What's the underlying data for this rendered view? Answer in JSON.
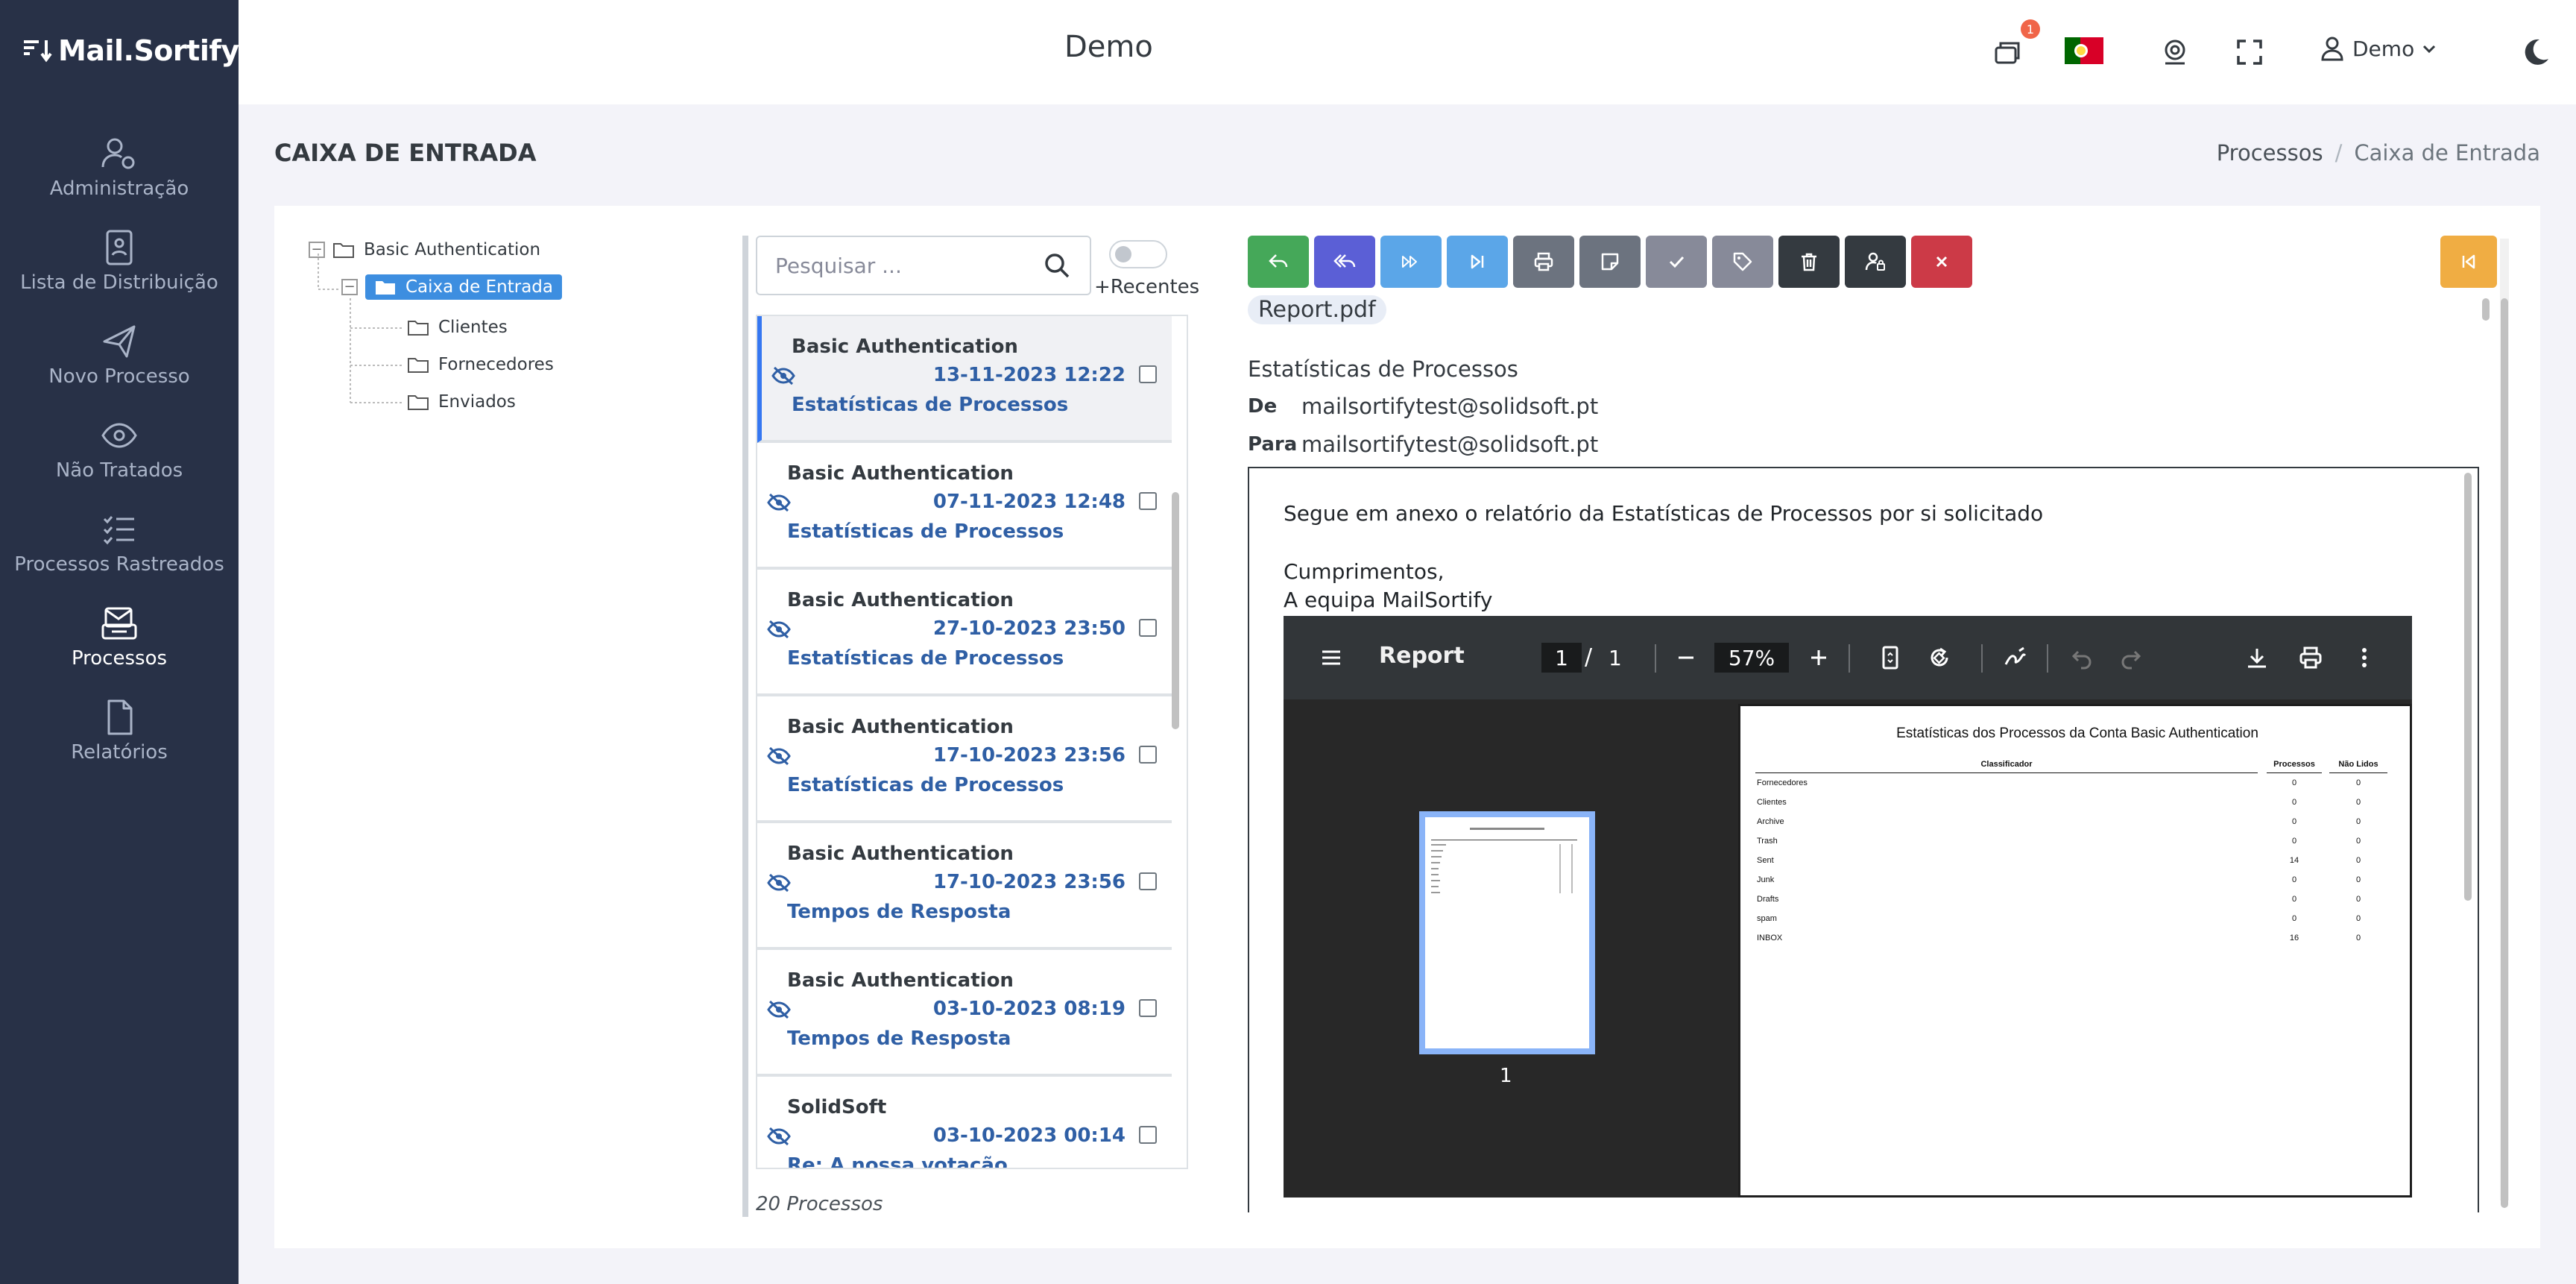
{
  "app": {
    "logo": "Mail.Sortify",
    "header_title": "Demo",
    "notification_count": "1",
    "user_name": "Demo"
  },
  "sidebar": {
    "items": [
      {
        "label": "Administração",
        "icon": "users-gear-icon"
      },
      {
        "label": "Lista de Distribuição",
        "icon": "contact-book-icon"
      },
      {
        "label": "Novo Processo",
        "icon": "paper-plane-icon"
      },
      {
        "label": "Não Tratados",
        "icon": "eye-icon"
      },
      {
        "label": "Processos Rastreados",
        "icon": "list-check-icon"
      },
      {
        "label": "Processos",
        "icon": "mail-stack-icon",
        "active": true
      },
      {
        "label": "Relatórios",
        "icon": "file-icon"
      }
    ]
  },
  "page": {
    "title": "CAIXA DE ENTRADA",
    "breadcrumb": [
      "Processos",
      "Caixa de Entrada"
    ]
  },
  "tree": {
    "root": "Basic Authentication",
    "selected": "Caixa de Entrada",
    "children": [
      "Clientes",
      "Fornecedores",
      "Enviados"
    ]
  },
  "list": {
    "search_placeholder": "Pesquisar ...",
    "recent_label": "+Recentes",
    "count_label": "20 Processos",
    "messages": [
      {
        "from": "Basic Authentication",
        "date": "13-11-2023 12:22",
        "subject": "Estatísticas de Processos",
        "active": true
      },
      {
        "from": "Basic Authentication",
        "date": "07-11-2023 12:48",
        "subject": "Estatísticas de Processos"
      },
      {
        "from": "Basic Authentication",
        "date": "27-10-2023 23:50",
        "subject": "Estatísticas de Processos"
      },
      {
        "from": "Basic Authentication",
        "date": "17-10-2023 23:56",
        "subject": "Estatísticas de Processos"
      },
      {
        "from": "Basic Authentication",
        "date": "17-10-2023 23:56",
        "subject": "Tempos de Resposta"
      },
      {
        "from": "Basic Authentication",
        "date": "03-10-2023 08:19",
        "subject": "Tempos de Resposta"
      },
      {
        "from": "SolidSoft",
        "date": "03-10-2023 00:14",
        "subject": "Re: A nossa votação"
      }
    ]
  },
  "toolbar": {
    "buttons": [
      {
        "name": "reply-button",
        "icon": "reply-icon",
        "color": "#45a859"
      },
      {
        "name": "reply-all-button",
        "icon": "reply-all-icon",
        "color": "#5b5fd6"
      },
      {
        "name": "forward-button",
        "icon": "forward-icon",
        "color": "#5ba6e8"
      },
      {
        "name": "next-button",
        "icon": "skip-forward-icon",
        "color": "#5ba6e8"
      },
      {
        "name": "print-button",
        "icon": "printer-icon",
        "color": "#6c737f"
      },
      {
        "name": "note-button",
        "icon": "note-icon",
        "color": "#6c737f"
      },
      {
        "name": "mark-done-button",
        "icon": "check-icon",
        "color": "#878a99"
      },
      {
        "name": "tag-button",
        "icon": "tag-icon",
        "color": "#878a99"
      },
      {
        "name": "delete-button",
        "icon": "trash-icon",
        "color": "#343a40"
      },
      {
        "name": "assign-user-button",
        "icon": "user-lock-icon",
        "color": "#343a40"
      },
      {
        "name": "close-button",
        "icon": "close-icon",
        "color": "#cc3a47"
      }
    ]
  },
  "mail": {
    "attachment": "Report.pdf",
    "subject": "Estatísticas de Processos",
    "from_label": "De",
    "from": "mailsortifytest@solidsoft.pt",
    "to_label": "Para",
    "to": "mailsortifytest@solidsoft.pt",
    "body_lines": [
      "Segue em anexo o relatório da Estatísticas de Processos por si solicitado",
      "Cumprimentos,",
      "A equipa MailSortify"
    ]
  },
  "pdf": {
    "title": "Report",
    "page": "1",
    "separator": "/",
    "total_pages": "1",
    "zoom": "57%",
    "thumb_page_number": "1",
    "report": {
      "title": "Estatísticas dos Processos da Conta Basic Authentication",
      "columns": [
        "Classificador",
        "Processos",
        "Não Lidos"
      ],
      "rows": [
        [
          "Fornecedores",
          "0",
          "0"
        ],
        [
          "Clientes",
          "0",
          "0"
        ],
        [
          "Archive",
          "0",
          "0"
        ],
        [
          "Trash",
          "0",
          "0"
        ],
        [
          "Sent",
          "14",
          "0"
        ],
        [
          "Junk",
          "0",
          "0"
        ],
        [
          "Drafts",
          "0",
          "0"
        ],
        [
          "spam",
          "0",
          "0"
        ],
        [
          "INBOX",
          "16",
          "0"
        ]
      ]
    }
  }
}
